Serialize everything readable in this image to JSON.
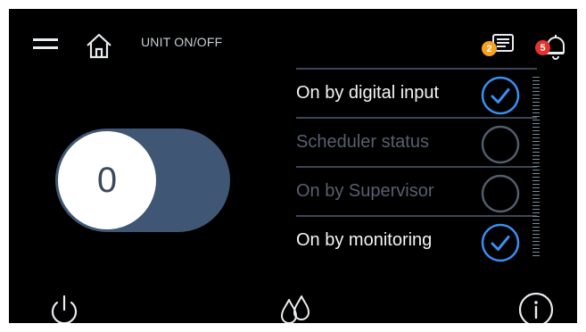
{
  "header": {
    "title": "UNIT ON/OFF",
    "messages_count": "2",
    "alarms_count": "5"
  },
  "toggle": {
    "value": "0",
    "state": "off"
  },
  "status_list": [
    {
      "label": "On by digital input",
      "checked": true,
      "active": true
    },
    {
      "label": "Scheduler status",
      "checked": false,
      "active": false
    },
    {
      "label": "On by Supervisor",
      "checked": false,
      "active": false
    },
    {
      "label": "On by monitoring",
      "checked": true,
      "active": true
    }
  ],
  "colors": {
    "accent_blue": "#3a8ff0",
    "toggle_track": "#3f5774",
    "badge_orange": "#f6a21d",
    "badge_red": "#e5322d"
  },
  "icons": [
    "menu-icon",
    "home-icon",
    "messages-icon",
    "bell-icon",
    "power-icon",
    "drops-icon",
    "info-icon"
  ]
}
